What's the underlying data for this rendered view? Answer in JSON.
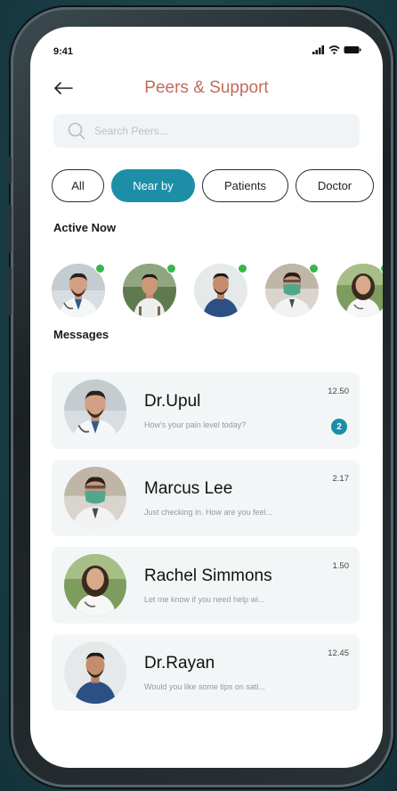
{
  "status_bar": {
    "time": "9:41"
  },
  "header": {
    "title": "Peers & Support"
  },
  "search": {
    "placeholder": "Search Peers..."
  },
  "filters": [
    {
      "label": "All",
      "active": false
    },
    {
      "label": "Near by",
      "active": true
    },
    {
      "label": "Patients",
      "active": false
    },
    {
      "label": "Doctor",
      "active": false
    }
  ],
  "active_now": {
    "label": "Active Now",
    "users": [
      {
        "avatar": "doctor-white-coat",
        "online": true
      },
      {
        "avatar": "doctor-outdoor",
        "online": true
      },
      {
        "avatar": "man-blue-shirt",
        "online": true
      },
      {
        "avatar": "man-mask",
        "online": true
      },
      {
        "avatar": "woman-doctor",
        "online": true
      }
    ]
  },
  "messages": {
    "label": "Messages",
    "items": [
      {
        "name": "Dr.Upul",
        "preview": "How's your pain level today?",
        "time": "12.50",
        "unread": "2"
      },
      {
        "name": "Marcus Lee",
        "preview": "Just checking in. How are you feel...",
        "time": "2.17",
        "unread": ""
      },
      {
        "name": "Rachel Simmons",
        "preview": "Let me know if you need help wi...",
        "time": "1.50",
        "unread": ""
      },
      {
        "name": "Dr.Rayan",
        "preview": "Would you like some tips on sati...",
        "time": "12.45",
        "unread": ""
      }
    ]
  },
  "colors": {
    "accent": "#1c8fa7",
    "title": "#c26b5b",
    "online": "#38b54a"
  }
}
